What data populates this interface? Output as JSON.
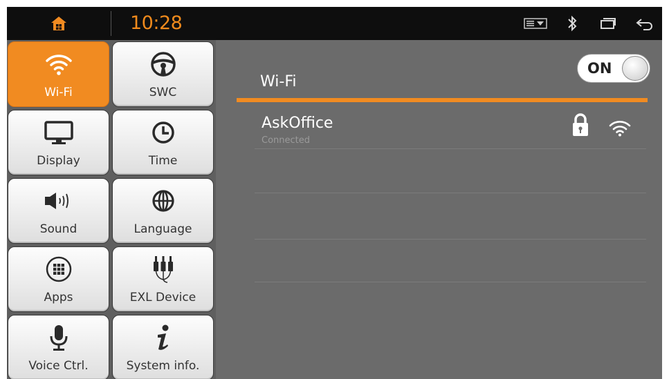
{
  "status_bar": {
    "time": "10:28",
    "icons": [
      "home-icon",
      "media-icon",
      "bluetooth-icon",
      "window-icon",
      "back-icon"
    ]
  },
  "sidebar": {
    "items": [
      {
        "label": "Wi-Fi",
        "icon": "wifi-icon",
        "active": true
      },
      {
        "label": "SWC",
        "icon": "steering-wheel-icon",
        "active": false
      },
      {
        "label": "Display",
        "icon": "monitor-icon",
        "active": false
      },
      {
        "label": "Time",
        "icon": "clock-icon",
        "active": false
      },
      {
        "label": "Sound",
        "icon": "speaker-icon",
        "active": false
      },
      {
        "label": "Language",
        "icon": "globe-icon",
        "active": false
      },
      {
        "label": "Apps",
        "icon": "apps-grid-icon",
        "active": false
      },
      {
        "label": "EXL Device",
        "icon": "audio-jacks-icon",
        "active": false
      },
      {
        "label": "Voice Ctrl.",
        "icon": "microphone-icon",
        "active": false
      },
      {
        "label": "System info.",
        "icon": "info-icon",
        "active": false
      }
    ]
  },
  "wifi": {
    "title": "Wi-Fi",
    "toggle_label": "ON",
    "toggle_on": true,
    "networks": [
      {
        "name": "AskOffice",
        "status": "Connected",
        "secured": true,
        "icons": [
          "lock-icon",
          "wifi-signal-icon"
        ]
      }
    ]
  },
  "colors": {
    "accent": "#f18b21",
    "status_bar": "#0e0e0e",
    "panel": "#6b6b6b",
    "clock": "#f08a1c"
  }
}
